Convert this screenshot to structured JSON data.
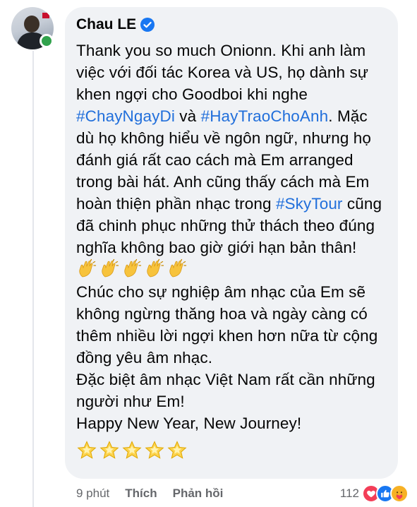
{
  "comment": {
    "author": "Chau LE",
    "verified": true,
    "segments": [
      {
        "t": "Thank you so much Onionn. Khi anh làm việc với đối tác Korea và US, họ dành sự khen ngợi cho Goodboi khi nghe ",
        "tag": false
      },
      {
        "t": "#ChayNgayDi",
        "tag": true
      },
      {
        "t": "  và ",
        "tag": false
      },
      {
        "t": "#HayTraoChoAnh",
        "tag": true
      },
      {
        "t": ". Mặc dù họ không hiểu về ngôn ngữ, nhưng họ đánh giá rất cao cách mà Em arranged trong bài hát. Anh cũng thấy cách mà Em hoàn thiện phần nhạc trong ",
        "tag": false
      },
      {
        "t": "#SkyTour",
        "tag": true
      },
      {
        "t": " cũng đã chinh phục những thử thách theo đúng nghĩa không bao giờ giới hạn bản thân! ",
        "tag": false
      }
    ],
    "clap_count": 5,
    "paragraph2": "Chúc cho sự nghiệp âm nhạc của Em sẽ không ngừng thăng hoa và ngày càng có thêm nhiều lời  ngợi khen hơn nữa từ cộng đồng yêu âm nhạc.",
    "paragraph3": "Đặc biệt âm nhạc Việt Nam rất cần những người như Em!",
    "paragraph4": "Happy New Year, New Journey!",
    "star_count": 5
  },
  "footer": {
    "time": "9 phút",
    "like": "Thích",
    "reply": "Phản hồi",
    "reaction_count": "112"
  },
  "icons": {
    "verified": "verified-badge-icon",
    "clap": "clapping-hands-emoji",
    "star": "star-emoji",
    "love": "heart-reaction-icon",
    "like": "thumbs-up-reaction-icon",
    "care": "care-reaction-icon"
  },
  "colors": {
    "bubble": "#f0f2f5",
    "hashtag": "#216fdb",
    "meta": "#65676b",
    "online": "#31a24c",
    "verified": "#1877f2"
  }
}
